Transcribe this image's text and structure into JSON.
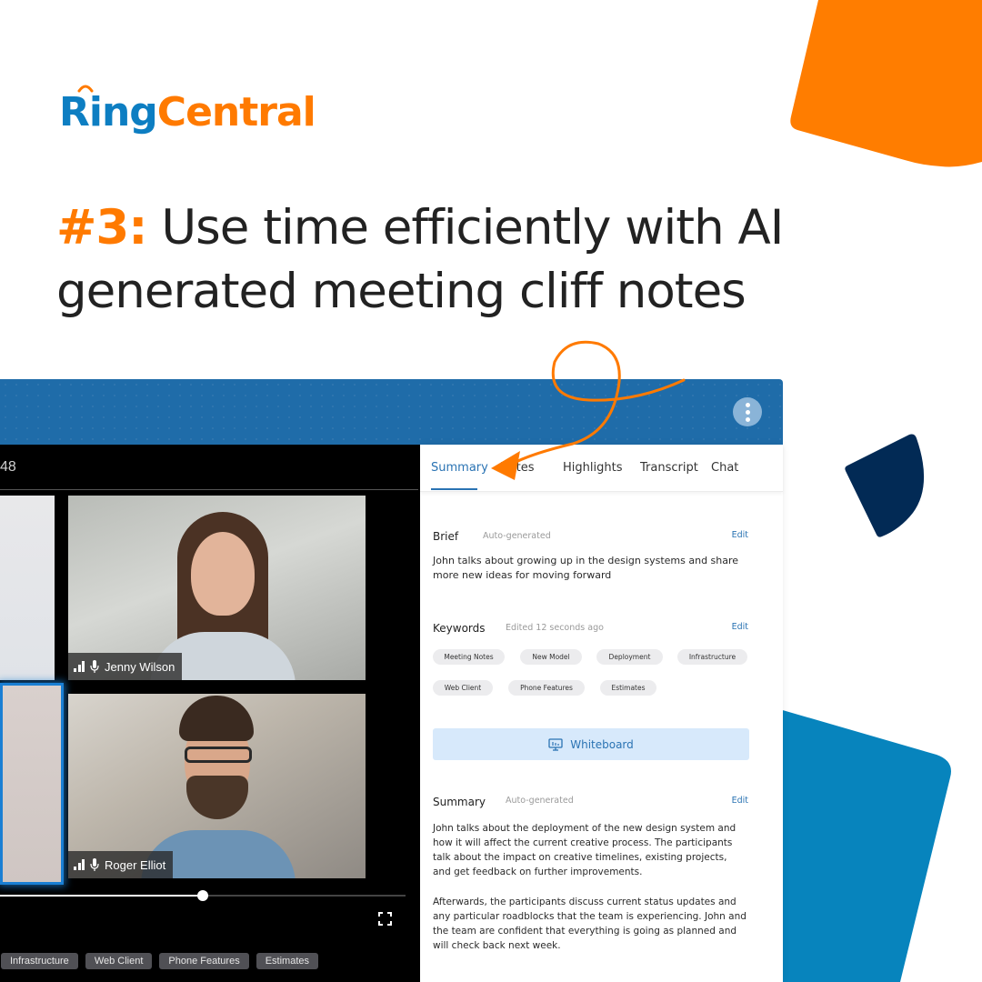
{
  "brand": {
    "logo_part1": "Ring",
    "logo_part2": "Central",
    "accent_orange": "#ff7a00",
    "accent_blue": "#0d7ec2",
    "navy": "#012b57"
  },
  "headline": {
    "number": "#3:",
    "line1_rest": " Use time efficiently with AI",
    "line2": "generated meeting cliff notes"
  },
  "app": {
    "topbar": {
      "more_icon": "vertical-dots-icon"
    },
    "video": {
      "timer_partial": "48",
      "participants": [
        {
          "name": "Jenny Wilson",
          "icons": [
            "signal-bars-icon",
            "microphone-icon"
          ]
        },
        {
          "name": "Roger Elliot",
          "icons": [
            "signal-bars-icon",
            "microphone-icon"
          ]
        }
      ],
      "progress_fraction": 0.5,
      "chips": [
        "Infrastructure",
        "Web Client",
        "Phone Features",
        "Estimates"
      ]
    },
    "panel": {
      "tabs": [
        "Summary",
        "Notes",
        "Highlights",
        "Transcript",
        "Chat"
      ],
      "active_tab": "Summary",
      "brief": {
        "title": "Brief",
        "meta": "Auto-generated",
        "edit": "Edit",
        "text": "John talks about growing up in the design systems and share more new ideas for moving forward"
      },
      "keywords": {
        "title": "Keywords",
        "meta": "Edited 12 seconds ago",
        "edit": "Edit",
        "chips": [
          "Meeting Notes",
          "New Model",
          "Deployment",
          "Infrastructure",
          "Web Client",
          "Phone Features",
          "Estimates"
        ]
      },
      "whiteboard_button": "Whiteboard",
      "summary": {
        "title": "Summary",
        "meta": "Auto-generated",
        "edit": "Edit",
        "paragraph1": "John talks about the deployment of the new design system and how it will affect the current creative process. The participants talk about the impact on creative timelines, existing projects, and get feedback on further improvements.",
        "paragraph2": "Afterwards, the participants discuss current status updates and any particular roadblocks that the team is experiencing. John and the team are confident that everything is going as planned and will check back next week."
      }
    }
  }
}
